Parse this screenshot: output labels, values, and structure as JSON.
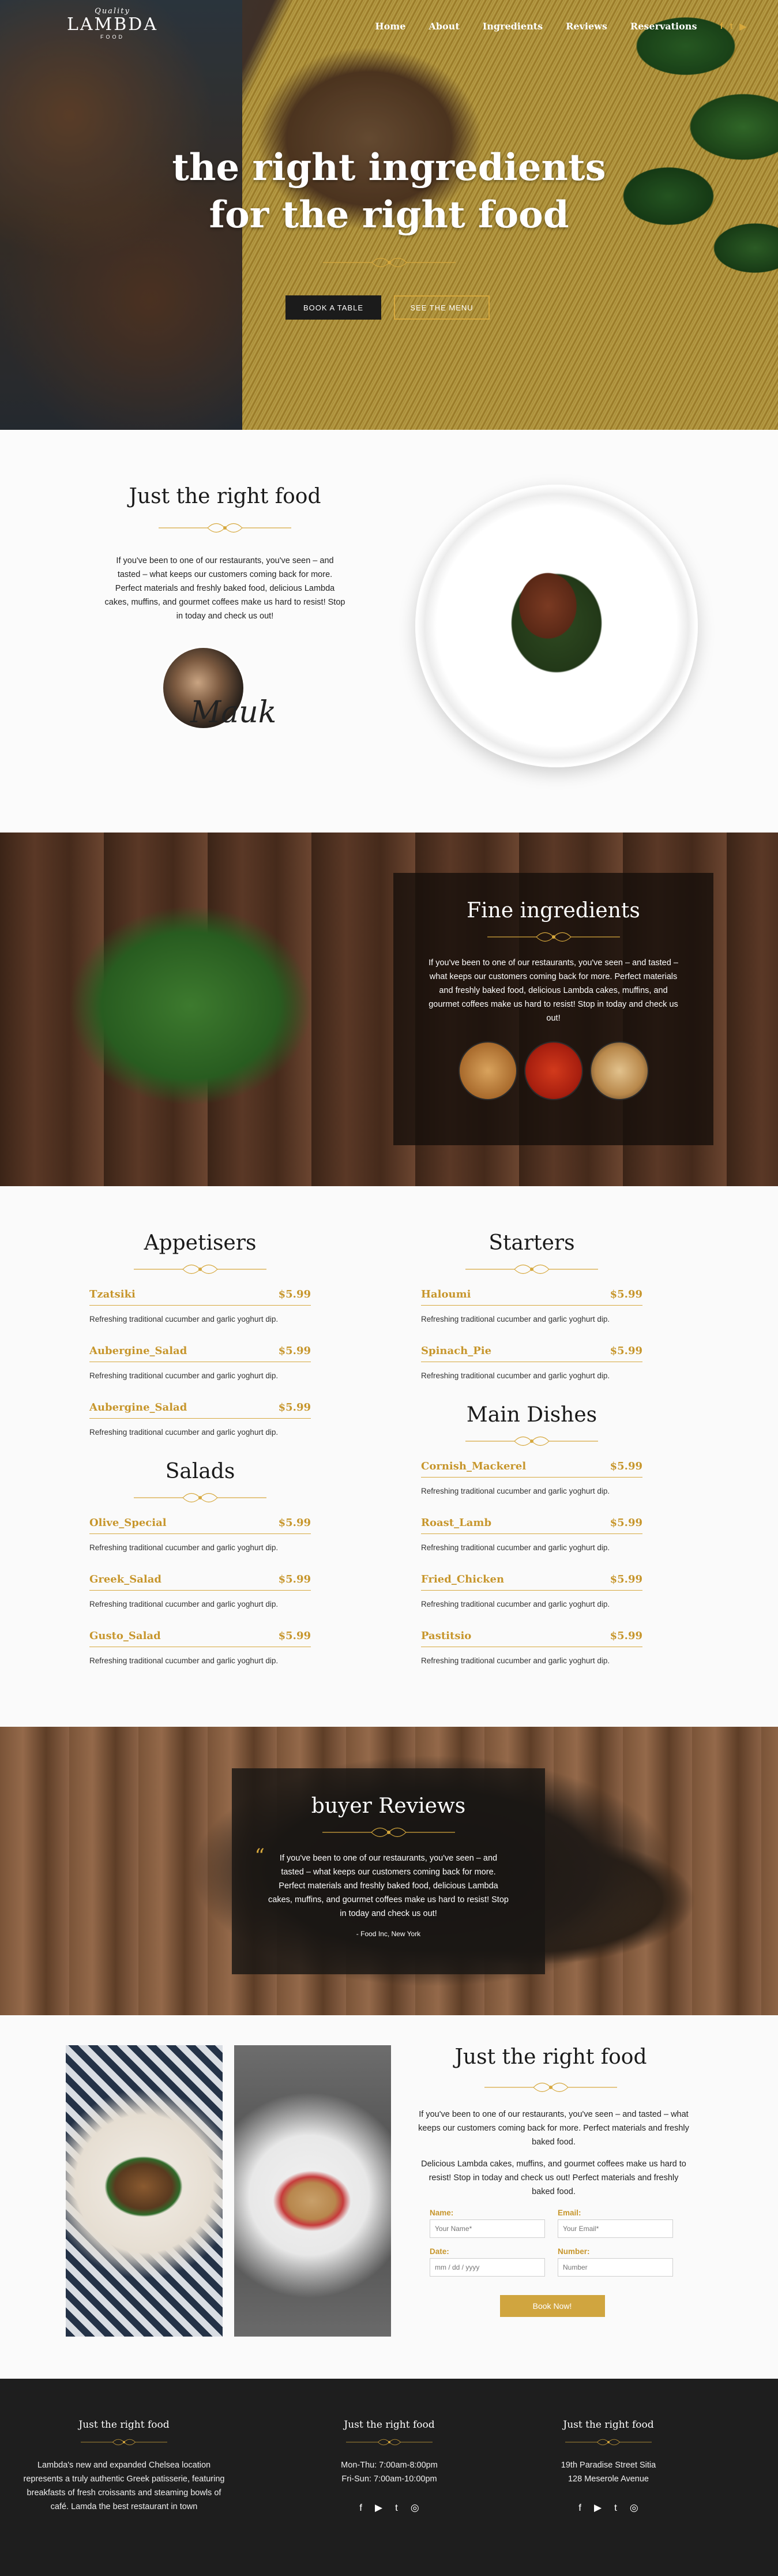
{
  "nav": {
    "logo_top": "Quality",
    "logo_brand": "LAMBDA",
    "logo_sub": "FOOD",
    "items": [
      {
        "label": "Home"
      },
      {
        "label": "About"
      },
      {
        "label": "Ingredients"
      },
      {
        "label": "Reviews"
      },
      {
        "label": "Reservations"
      }
    ],
    "social": [
      {
        "icon": "facebook-icon",
        "glyph": "f"
      },
      {
        "icon": "twitter-icon",
        "glyph": "t"
      },
      {
        "icon": "youtube-icon",
        "glyph": "▶"
      }
    ]
  },
  "hero": {
    "title_line1": "the right ingredients",
    "title_line2": "for the right food",
    "book_button": "BOOK A TABLE",
    "menu_button": "SEE THE MENU"
  },
  "about": {
    "title": "Just the right food",
    "text": "If you've been to one of our restaurants, you've seen – and tasted – what keeps our customers coming back for more. Perfect materials and freshly baked food, delicious Lambda cakes, muffins, and gourmet coffees make us hard to resist! Stop in today and check us out!",
    "signature": "Mauk"
  },
  "ingredients": {
    "title": "Fine ingredients",
    "text": "If you've been to one of our restaurants, you've seen – and tasted – what keeps our customers coming back for more. Perfect materials and freshly baked food, delicious Lambda cakes, muffins, and gourmet coffees make us hard to resist! Stop in today and check us out!"
  },
  "menu": {
    "appetisers": {
      "title": "Appetisers",
      "items": [
        {
          "name": "Tzatsiki",
          "price": "$5.99",
          "desc": "Refreshing traditional cucumber and garlic yoghurt dip."
        },
        {
          "name": "Aubergine_Salad",
          "price": "$5.99",
          "desc": "Refreshing traditional cucumber and garlic yoghurt dip."
        },
        {
          "name": "Aubergine_Salad",
          "price": "$5.99",
          "desc": "Refreshing traditional cucumber and garlic yoghurt dip."
        }
      ]
    },
    "salads": {
      "title": "Salads",
      "items": [
        {
          "name": "Olive_Special",
          "price": "$5.99",
          "desc": "Refreshing traditional cucumber and garlic yoghurt dip."
        },
        {
          "name": "Greek_Salad",
          "price": "$5.99",
          "desc": "Refreshing traditional cucumber and garlic yoghurt dip."
        },
        {
          "name": "Gusto_Salad",
          "price": "$5.99",
          "desc": "Refreshing traditional cucumber and garlic yoghurt dip."
        }
      ]
    },
    "starters": {
      "title": "Starters",
      "items": [
        {
          "name": "Haloumi",
          "price": "$5.99",
          "desc": "Refreshing traditional cucumber and garlic yoghurt dip."
        },
        {
          "name": "Spinach_Pie",
          "price": "$5.99",
          "desc": "Refreshing traditional cucumber and garlic yoghurt dip."
        }
      ]
    },
    "mains": {
      "title": "Main Dishes",
      "items": [
        {
          "name": "Cornish_Mackerel",
          "price": "$5.99",
          "desc": "Refreshing traditional cucumber and garlic yoghurt dip."
        },
        {
          "name": "Roast_Lamb",
          "price": "$5.99",
          "desc": "Refreshing traditional cucumber and garlic yoghurt dip."
        },
        {
          "name": "Fried_Chicken",
          "price": "$5.99",
          "desc": "Refreshing traditional cucumber and garlic yoghurt dip."
        },
        {
          "name": "Pastitsio",
          "price": "$5.99",
          "desc": "Refreshing traditional cucumber and garlic yoghurt dip."
        }
      ]
    }
  },
  "reviews": {
    "title": "buyer Reviews",
    "quote": "If you've been to one of our restaurants, you've seen – and tasted – what keeps our customers coming back for more. Perfect materials and freshly baked food, delicious Lambda cakes, muffins, and gourmet coffees make us hard to resist! Stop in today and check us out!",
    "author": "- Food Inc, New York"
  },
  "booking": {
    "title": "Just the right food",
    "p1": "If you've been to one of our restaurants, you've seen – and tasted – what keeps our customers coming back for more. Perfect materials and freshly baked food.",
    "p2": "Delicious Lambda cakes, muffins, and gourmet coffees make us hard to resist! Stop in today and check us out! Perfect materials and freshly baked food.",
    "name_label": "Name:",
    "name_placeholder": "Your Name*",
    "email_label": "Email:",
    "email_placeholder": "Your Email*",
    "date_label": "Date:",
    "date_placeholder": "mm / dd / yyyy",
    "number_label": "Number:",
    "number_placeholder": "Number",
    "submit": "Book Now!"
  },
  "footer": {
    "col1": {
      "title": "Just the right food",
      "text": "Lambda's new and expanded Chelsea location represents a truly authentic Greek patisserie, featuring breakfasts of fresh croissants and steaming bowls of café. Lamda the best restaurant in town"
    },
    "col2": {
      "title": "Just the right food",
      "line1": "Mon-Thu: 7:00am-8:00pm",
      "line2": "Fri-Sun: 7:00am-10:00pm"
    },
    "col3": {
      "title": "Just the right food",
      "line1": "19th Paradise Street Sitia",
      "line2": "128 Meserole Avenue"
    },
    "social": {
      "facebook": "f",
      "youtube": "▶",
      "twitter": "t",
      "instagram": "◎"
    }
  }
}
